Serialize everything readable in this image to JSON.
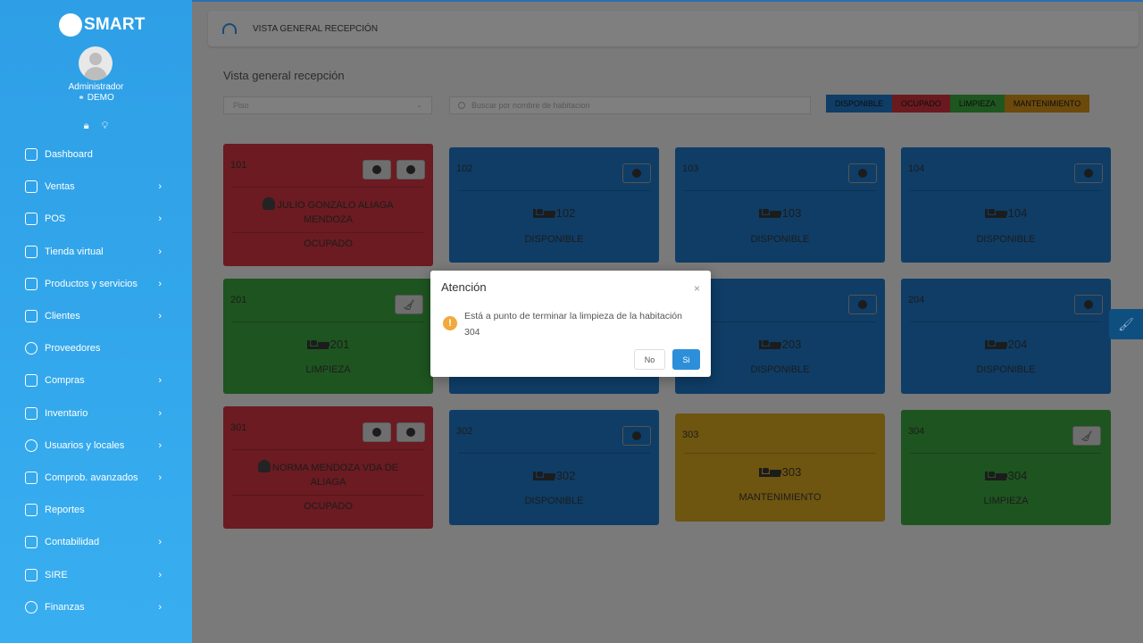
{
  "brand": {
    "name": "SMART"
  },
  "user": {
    "role": "Administrador",
    "company": "DEMO"
  },
  "nav": [
    {
      "label": "Dashboard",
      "icon": "home-icon",
      "has_children": false
    },
    {
      "label": "Ventas",
      "icon": "document-icon",
      "has_children": true
    },
    {
      "label": "POS",
      "icon": "pos-icon",
      "has_children": true
    },
    {
      "label": "Tienda virtual",
      "icon": "store-icon",
      "has_children": true
    },
    {
      "label": "Productos y servicios",
      "icon": "box-icon",
      "has_children": true
    },
    {
      "label": "Clientes",
      "icon": "clients-icon",
      "has_children": true
    },
    {
      "label": "Proveedores",
      "icon": "user-icon",
      "has_children": false
    },
    {
      "label": "Compras",
      "icon": "cart-icon",
      "has_children": true
    },
    {
      "label": "Inventario",
      "icon": "book-icon",
      "has_children": true
    },
    {
      "label": "Usuarios y locales",
      "icon": "user-icon",
      "has_children": true
    },
    {
      "label": "Comprob. avanzados",
      "icon": "document-icon",
      "has_children": true
    },
    {
      "label": "Reportes",
      "icon": "report-icon",
      "has_children": false
    },
    {
      "label": "Contabilidad",
      "icon": "chart-icon",
      "has_children": true
    },
    {
      "label": "SIRE",
      "icon": "sire-icon",
      "has_children": true
    },
    {
      "label": "Finanzas",
      "icon": "dollar-icon",
      "has_children": true
    }
  ],
  "header": {
    "title": "VISTA GENERAL RECEPCIÓN"
  },
  "page": {
    "title": "Vista general recepción",
    "floor_placeholder": "Piso",
    "search_placeholder": "Buscar por nombre de habitacion"
  },
  "legend": {
    "available": "DISPONIBLE",
    "occupied": "OCUPADO",
    "cleaning": "LIMPIEZA",
    "maintenance": "MANTENIMIENTO"
  },
  "rooms": {
    "r101": {
      "number": "101",
      "guest": "JULIO GONZALO ALIAGA MENDOZA",
      "status": "OCUPADO"
    },
    "r102": {
      "number": "102",
      "label": "102",
      "status": "DISPONIBLE"
    },
    "r103": {
      "number": "103",
      "label": "103",
      "status": "DISPONIBLE"
    },
    "r104": {
      "number": "104",
      "label": "104",
      "status": "DISPONIBLE"
    },
    "r201": {
      "number": "201",
      "label": "201",
      "status": "LIMPIEZA"
    },
    "r203": {
      "label": "203",
      "status": "DISPONIBLE"
    },
    "r204": {
      "number": "204",
      "label": "204",
      "status": "DISPONIBLE"
    },
    "r301": {
      "number": "301",
      "guest": "NORMA MENDOZA VDA DE ALIAGA",
      "status": "OCUPADO"
    },
    "r302": {
      "number": "302",
      "label": "302",
      "status": "DISPONIBLE"
    },
    "r303": {
      "number": "303",
      "label": "303",
      "status": "MANTENIMIENTO"
    },
    "r304": {
      "number": "304",
      "label": "304",
      "status": "LIMPIEZA"
    }
  },
  "modal": {
    "title": "Atención",
    "message": "Está a punto de terminar la limpieza de la habitación 304",
    "no_label": "No",
    "yes_label": "Si"
  }
}
